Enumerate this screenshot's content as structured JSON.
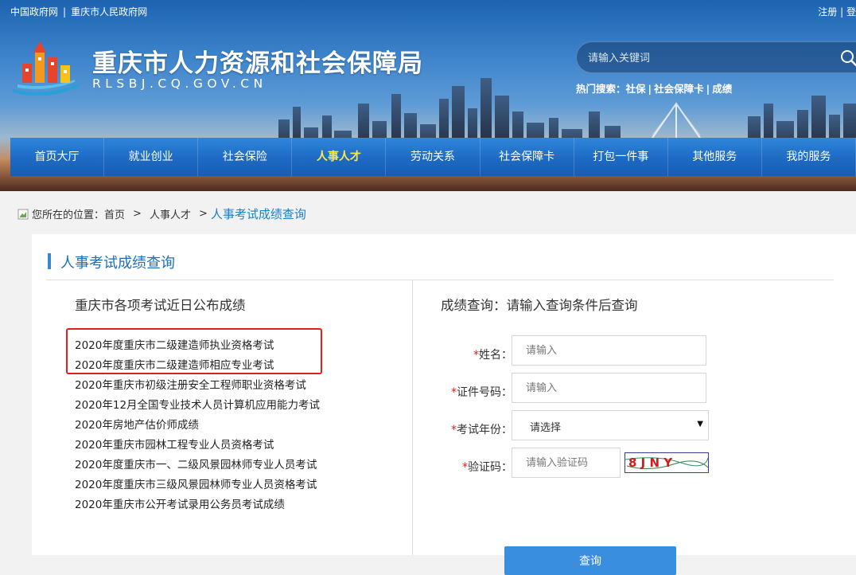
{
  "top_links": [
    "中国政府网",
    "|",
    "重庆市人民政府网"
  ],
  "top_right": [
    "注册",
    "|",
    "登"
  ],
  "site": {
    "title": "重庆市人力资源和社会保障局",
    "domain": "RLSBJ.CQ.GOV.CN"
  },
  "search": {
    "placeholder": "请输入关键词"
  },
  "hot_search": {
    "label": "热门搜索：",
    "items": [
      "社保",
      "社会保障卡",
      "成绩"
    ]
  },
  "nav": [
    "首页大厅",
    "就业创业",
    "社会保险",
    "人事人才",
    "劳动关系",
    "社会保障卡",
    "打包一件事",
    "其他服务",
    "我的服务"
  ],
  "nav_active": "人事人才",
  "breadcrumb": {
    "prefix": "您所在的位置：",
    "items": [
      "首页",
      "人事人才",
      "人事考试成绩查询"
    ],
    "separator": ">"
  },
  "panel": {
    "title": "人事考试成绩查询"
  },
  "left": {
    "heading": "重庆市各项考试近日公布成绩",
    "exams": [
      "2020年度重庆市二级建造师执业资格考试",
      "2020年度重庆市二级建造师相应专业考试",
      "2020年重庆市初级注册安全工程师职业资格考试",
      "2020年12月全国专业技术人员计算机应用能力考试",
      "2020年房地产估价师成绩",
      "2020年重庆市园林工程专业人员资格考试",
      "2020年度重庆市一、二级风景园林师专业人员考试",
      "2020年度重庆市三级风景园林师专业人员资格考试",
      "2020年重庆市公开考试录用公务员考试成绩"
    ]
  },
  "right": {
    "heading": "成绩查询：请输入查询条件后查询",
    "fields": {
      "name": {
        "required": "*",
        "label": "姓名：",
        "placeholder": "请输入"
      },
      "id_number": {
        "required": "*",
        "label": "证件号码：",
        "placeholder": "请输入"
      },
      "year": {
        "required": "*",
        "label": "考试年份：",
        "value": "请选择"
      },
      "captcha": {
        "required": "*",
        "label": "验证码：",
        "placeholder": "请输入验证码"
      }
    },
    "captcha_image_text": "8 J N Y",
    "submit_label": "查询"
  },
  "colors": {
    "nav_bg": "#1d6ac4",
    "nav_active": "#ffe94a",
    "accent": "#3a8ee0",
    "highlight_border": "#e01e1e"
  }
}
